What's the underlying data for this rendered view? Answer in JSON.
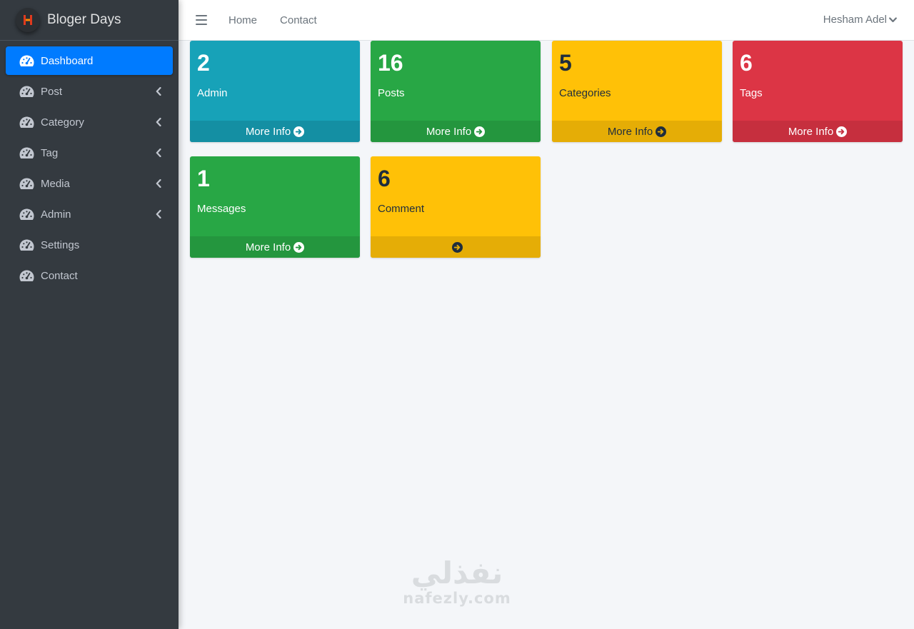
{
  "brand": {
    "title": "Bloger Days",
    "logo_letter": "H"
  },
  "sidebar": {
    "items": [
      {
        "label": "Dashboard",
        "active": true,
        "has_submenu": false
      },
      {
        "label": "Post",
        "active": false,
        "has_submenu": true
      },
      {
        "label": "Category",
        "active": false,
        "has_submenu": true
      },
      {
        "label": "Tag",
        "active": false,
        "has_submenu": true
      },
      {
        "label": "Media",
        "active": false,
        "has_submenu": true
      },
      {
        "label": "Admin",
        "active": false,
        "has_submenu": true
      },
      {
        "label": "Settings",
        "active": false,
        "has_submenu": false
      },
      {
        "label": "Contact",
        "active": false,
        "has_submenu": false
      }
    ]
  },
  "topbar": {
    "links": [
      "Home",
      "Contact"
    ],
    "user_name": "Hesham Adel"
  },
  "cards": [
    {
      "count": "2",
      "label": "Admin",
      "link": "More Info",
      "color": "info"
    },
    {
      "count": "16",
      "label": "Posts",
      "link": "More Info",
      "color": "success"
    },
    {
      "count": "5",
      "label": "Categories",
      "link": "More Info",
      "color": "warning"
    },
    {
      "count": "6",
      "label": "Tags",
      "link": "More Info",
      "color": "danger"
    },
    {
      "count": "1",
      "label": "Messages",
      "link": "More Info",
      "color": "success"
    },
    {
      "count": "6",
      "label": "Comment",
      "link": "",
      "color": "warning"
    }
  ],
  "watermark": {
    "arabic": "نفذلي",
    "latin": "nafezly.com"
  },
  "colors": {
    "sidebar_bg": "#343a40",
    "primary": "#007bff",
    "info": "#17a2b8",
    "success": "#28a745",
    "warning": "#ffc107",
    "danger": "#dc3545",
    "content_bg": "#f4f6f9"
  },
  "icons": {
    "nav": "tachometer-icon",
    "submenu": "chevron-left-icon",
    "more_info": "arrow-circle-right-icon",
    "user_menu": "chevron-down-icon",
    "menu_toggle": "hamburger-icon"
  }
}
